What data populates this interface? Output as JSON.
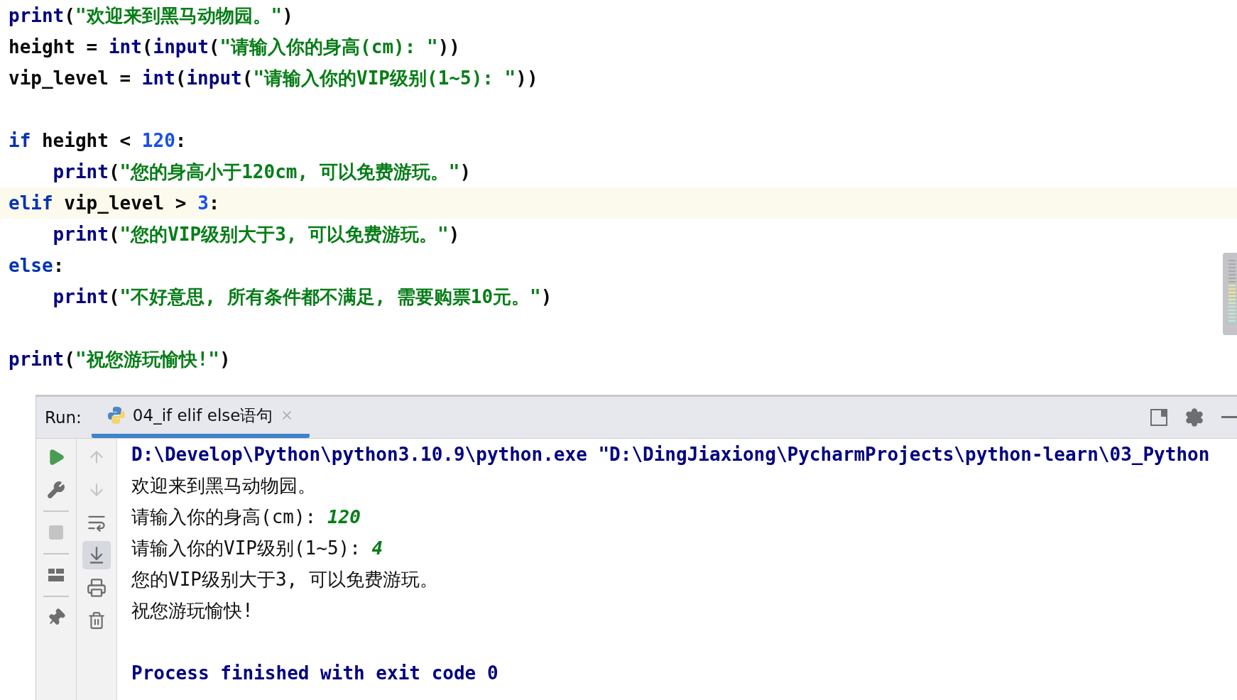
{
  "editor": {
    "lines": [
      {
        "kind": "code",
        "current": false,
        "tokens": [
          {
            "kind": "call",
            "text": "print"
          },
          {
            "kind": "punct",
            "text": "("
          },
          {
            "kind": "string",
            "text": "\"欢迎来到黑马动物园。\""
          },
          {
            "kind": "punct",
            "text": ")"
          }
        ]
      },
      {
        "kind": "code",
        "current": false,
        "tokens": [
          {
            "kind": "ident",
            "text": "height = "
          },
          {
            "kind": "call",
            "text": "int"
          },
          {
            "kind": "punct",
            "text": "("
          },
          {
            "kind": "call",
            "text": "input"
          },
          {
            "kind": "punct",
            "text": "("
          },
          {
            "kind": "string",
            "text": "\"请输入你的身高(cm): \""
          },
          {
            "kind": "punct",
            "text": "))"
          }
        ]
      },
      {
        "kind": "code",
        "current": false,
        "tokens": [
          {
            "kind": "ident",
            "text": "vip_level = "
          },
          {
            "kind": "call",
            "text": "int"
          },
          {
            "kind": "punct",
            "text": "("
          },
          {
            "kind": "call",
            "text": "input"
          },
          {
            "kind": "punct",
            "text": "("
          },
          {
            "kind": "string",
            "text": "\"请输入你的VIP级别(1~5): \""
          },
          {
            "kind": "punct",
            "text": "))"
          }
        ]
      },
      {
        "kind": "blank"
      },
      {
        "kind": "code",
        "current": false,
        "tokens": [
          {
            "kind": "keyword",
            "text": "if"
          },
          {
            "kind": "ident",
            "text": " height < "
          },
          {
            "kind": "number",
            "text": "120"
          },
          {
            "kind": "punct",
            "text": ":"
          }
        ]
      },
      {
        "kind": "code",
        "current": false,
        "tokens": [
          {
            "kind": "call",
            "text": "    print"
          },
          {
            "kind": "punct",
            "text": "("
          },
          {
            "kind": "string",
            "text": "\"您的身高小于120cm, 可以免费游玩。\""
          },
          {
            "kind": "punct",
            "text": ")"
          }
        ]
      },
      {
        "kind": "code",
        "current": true,
        "tokens": [
          {
            "kind": "keyword",
            "text": "elif"
          },
          {
            "kind": "ident",
            "text": " vip_level > "
          },
          {
            "kind": "number",
            "text": "3"
          },
          {
            "kind": "punct",
            "text": ":"
          }
        ]
      },
      {
        "kind": "code",
        "current": false,
        "tokens": [
          {
            "kind": "call",
            "text": "    print"
          },
          {
            "kind": "punct",
            "text": "("
          },
          {
            "kind": "string",
            "text": "\"您的VIP级别大于3, 可以免费游玩。\""
          },
          {
            "kind": "punct",
            "text": ")"
          }
        ]
      },
      {
        "kind": "code",
        "current": false,
        "tokens": [
          {
            "kind": "keyword",
            "text": "else"
          },
          {
            "kind": "punct",
            "text": ":"
          }
        ]
      },
      {
        "kind": "code",
        "current": false,
        "tokens": [
          {
            "kind": "call",
            "text": "    print"
          },
          {
            "kind": "punct",
            "text": "("
          },
          {
            "kind": "string",
            "text": "\"不好意思, 所有条件都不满足, 需要购票10元。\""
          },
          {
            "kind": "punct",
            "text": ")"
          }
        ]
      },
      {
        "kind": "blank"
      },
      {
        "kind": "code",
        "current": false,
        "tokens": [
          {
            "kind": "call",
            "text": "print"
          },
          {
            "kind": "punct",
            "text": "("
          },
          {
            "kind": "string",
            "text": "\"祝您游玩愉快!\""
          },
          {
            "kind": "punct",
            "text": ")"
          }
        ]
      }
    ]
  },
  "run_panel": {
    "label": "Run:",
    "tabs": [
      {
        "label": "04_if elif else语句",
        "selected": true
      }
    ],
    "left_toolbar": [
      {
        "kind": "run",
        "disabled": false
      },
      {
        "kind": "wrench",
        "disabled": false
      },
      {
        "kind": "divider"
      },
      {
        "kind": "stop",
        "disabled": true
      },
      {
        "kind": "divider"
      },
      {
        "kind": "layout",
        "disabled": false
      },
      {
        "kind": "divider"
      },
      {
        "kind": "pin",
        "disabled": false
      }
    ],
    "right_toolbar": [
      {
        "kind": "up",
        "disabled": true,
        "selected": false
      },
      {
        "kind": "down",
        "disabled": true,
        "selected": false
      },
      {
        "kind": "wrap",
        "disabled": false,
        "selected": false
      },
      {
        "kind": "scroll",
        "disabled": false,
        "selected": true
      },
      {
        "kind": "print",
        "disabled": false,
        "selected": false
      },
      {
        "kind": "trash",
        "disabled": false,
        "selected": false
      }
    ],
    "console": [
      {
        "kind": "command",
        "segments": [
          {
            "kind": "out",
            "text": "D:\\Develop\\Python\\python3.10.9\\python.exe \"D:\\DingJiaxiong\\PycharmProjects\\python-learn\\03_Python"
          }
        ]
      },
      {
        "kind": "output",
        "segments": [
          {
            "kind": "out",
            "text": "欢迎来到黑马动物园。"
          }
        ]
      },
      {
        "kind": "output",
        "segments": [
          {
            "kind": "out",
            "text": "请输入你的身高(cm): "
          },
          {
            "kind": "input",
            "text": "120"
          }
        ]
      },
      {
        "kind": "output",
        "segments": [
          {
            "kind": "out",
            "text": "请输入你的VIP级别(1~5): "
          },
          {
            "kind": "input",
            "text": "4"
          }
        ]
      },
      {
        "kind": "output",
        "segments": [
          {
            "kind": "out",
            "text": "您的VIP级别大于3, 可以免费游玩。"
          }
        ]
      },
      {
        "kind": "output",
        "segments": [
          {
            "kind": "out",
            "text": "祝您游玩愉快!"
          }
        ]
      },
      {
        "kind": "blank"
      },
      {
        "kind": "command",
        "segments": [
          {
            "kind": "out",
            "text": "Process finished with exit code 0"
          }
        ]
      }
    ]
  }
}
